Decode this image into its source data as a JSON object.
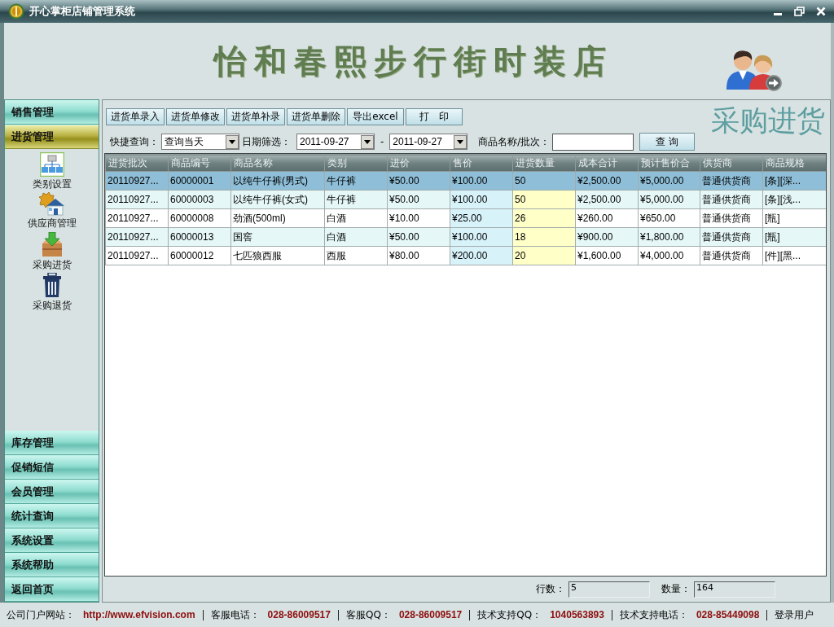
{
  "window": {
    "title": "开心掌柜店铺管理系统"
  },
  "banner": {
    "shop_name": "怡和春熙步行街时装店"
  },
  "sidebar": {
    "sections": [
      {
        "label": "销售管理",
        "selected": false
      },
      {
        "label": "进货管理",
        "selected": true,
        "children": [
          {
            "label": "类别设置"
          },
          {
            "label": "供应商管理"
          },
          {
            "label": "采购进货"
          },
          {
            "label": "采购退货"
          }
        ]
      },
      {
        "label": "库存管理",
        "selected": false
      },
      {
        "label": "促销短信",
        "selected": false
      },
      {
        "label": "会员管理",
        "selected": false
      },
      {
        "label": "统计查询",
        "selected": false
      },
      {
        "label": "系统设置",
        "selected": false
      },
      {
        "label": "系统帮助",
        "selected": false
      },
      {
        "label": "返回首页",
        "selected": false
      }
    ]
  },
  "toolbar": {
    "buttons": [
      "进货单录入",
      "进货单修改",
      "进货单补录",
      "进货单删除",
      "导出excel",
      "打　印"
    ]
  },
  "page_title": "采购进货",
  "filters": {
    "quick_query": {
      "label": "快捷查询：",
      "value": "查询当天"
    },
    "date_filter": {
      "label": "日期筛选：",
      "from": "2011-09-27",
      "separator": "-",
      "to": "2011-09-27"
    },
    "keyword": {
      "label": "商品名称/批次："
    },
    "search_button": "查 询"
  },
  "table": {
    "columns": [
      {
        "label": "进货批次",
        "kind": "plain"
      },
      {
        "label": "商品编号",
        "kind": "plain"
      },
      {
        "label": "商品名称",
        "kind": "plain"
      },
      {
        "label": "类别",
        "kind": "plain"
      },
      {
        "label": "进价",
        "kind": "plain"
      },
      {
        "label": "售价",
        "kind": "tinted"
      },
      {
        "label": "进货数量",
        "kind": "editable"
      },
      {
        "label": "成本合计",
        "kind": "plain"
      },
      {
        "label": "预计售价合",
        "kind": "plain"
      },
      {
        "label": "供货商",
        "kind": "plain"
      },
      {
        "label": "商品规格",
        "kind": "plain"
      }
    ],
    "rows": [
      {
        "selected": true,
        "cells": [
          "20110927...",
          "60000001",
          "以纯牛仔裤(男式)",
          "牛仔裤",
          "¥50.00",
          "¥100.00",
          "50",
          "¥2,500.00",
          "¥5,000.00",
          "普通供货商",
          "[条][深..."
        ]
      },
      {
        "selected": false,
        "cells": [
          "20110927...",
          "60000003",
          "以纯牛仔裤(女式)",
          "牛仔裤",
          "¥50.00",
          "¥100.00",
          "50",
          "¥2,500.00",
          "¥5,000.00",
          "普通供货商",
          "[条][浅..."
        ]
      },
      {
        "selected": false,
        "cells": [
          "20110927...",
          "60000008",
          "劲酒(500ml)",
          "白酒",
          "¥10.00",
          "¥25.00",
          "26",
          "¥260.00",
          "¥650.00",
          "普通供货商",
          "[瓶]"
        ]
      },
      {
        "selected": false,
        "cells": [
          "20110927...",
          "60000013",
          "国窖",
          "白酒",
          "¥50.00",
          "¥100.00",
          "18",
          "¥900.00",
          "¥1,800.00",
          "普通供货商",
          "[瓶]"
        ]
      },
      {
        "selected": false,
        "cells": [
          "20110927...",
          "60000012",
          "七匹狼西服",
          "西服",
          "¥80.00",
          "¥200.00",
          "20",
          "¥1,600.00",
          "¥4,000.00",
          "普通供货商",
          "[件][黑..."
        ]
      }
    ]
  },
  "summary": [
    {
      "label": "行数：",
      "value": "5"
    },
    {
      "label": "数量：",
      "value": "164"
    }
  ],
  "status_bar": [
    {
      "label": "公司门户网站：",
      "value": "http://www.efvision.com"
    },
    {
      "label": "客服电话：",
      "value": "028-86009517"
    },
    {
      "label": "客服QQ：",
      "value": "028-86009517"
    },
    {
      "label": "技术支持QQ：",
      "value": "1040563893"
    },
    {
      "label": "技术支持电话：",
      "value": "028-85449098"
    },
    {
      "label": "登录用户"
    }
  ]
}
